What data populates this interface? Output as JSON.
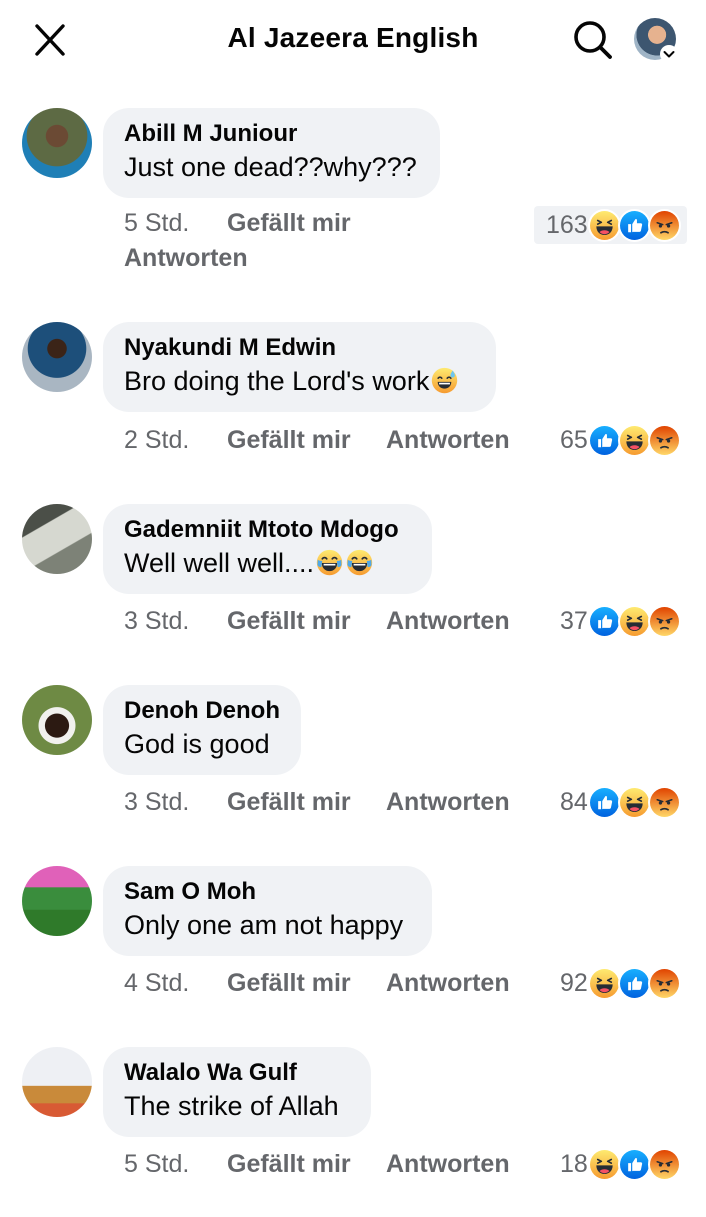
{
  "header": {
    "title": "Al Jazeera English"
  },
  "comments": [
    {
      "name": "Abill M Juniour",
      "text": "Just one dead??why???",
      "time": "5 Std.",
      "like_label": "Gefällt mir",
      "reply_label": "Antworten",
      "reaction_count": "163",
      "reactions": [
        "haha-icon",
        "like-icon",
        "angry-icon"
      ]
    },
    {
      "name": "Nyakundi M Edwin",
      "text": "Bro doing the Lord's work",
      "text_emoji": [
        "sweat-smile-emoji"
      ],
      "time": "2 Std.",
      "like_label": "Gefällt mir",
      "reply_label": "Antworten",
      "reaction_count": "65",
      "reactions": [
        "like-icon",
        "haha-icon",
        "angry-icon"
      ]
    },
    {
      "name": "Gademniit Mtoto Mdogo",
      "text": "Well well well....",
      "text_emoji": [
        "tears-of-joy-emoji",
        "tears-of-joy-emoji"
      ],
      "time": "3 Std.",
      "like_label": "Gefällt mir",
      "reply_label": "Antworten",
      "reaction_count": "37",
      "reactions": [
        "like-icon",
        "haha-icon",
        "angry-icon"
      ]
    },
    {
      "name": "Denoh Denoh",
      "text": "God is good",
      "time": "3 Std.",
      "like_label": "Gefällt mir",
      "reply_label": "Antworten",
      "reaction_count": "84",
      "reactions": [
        "like-icon",
        "haha-icon",
        "angry-icon"
      ]
    },
    {
      "name": "Sam O Moh",
      "text": "Only one am not happy",
      "time": "4 Std.",
      "like_label": "Gefällt mir",
      "reply_label": "Antworten",
      "reaction_count": "92",
      "reactions": [
        "haha-icon",
        "like-icon",
        "angry-icon"
      ]
    },
    {
      "name": "Walalo Wa Gulf",
      "text": "The strike of Allah",
      "time": "5 Std.",
      "like_label": "Gefällt mir",
      "reply_label": "Antworten",
      "reaction_count": "18",
      "reactions": [
        "haha-icon",
        "like-icon",
        "angry-icon"
      ]
    }
  ],
  "colors": {
    "like": "#1877f2",
    "haha": "#f7b125",
    "angry": "#e9573f",
    "bubble": "#f0f2f5",
    "meta_text": "#65676b"
  }
}
